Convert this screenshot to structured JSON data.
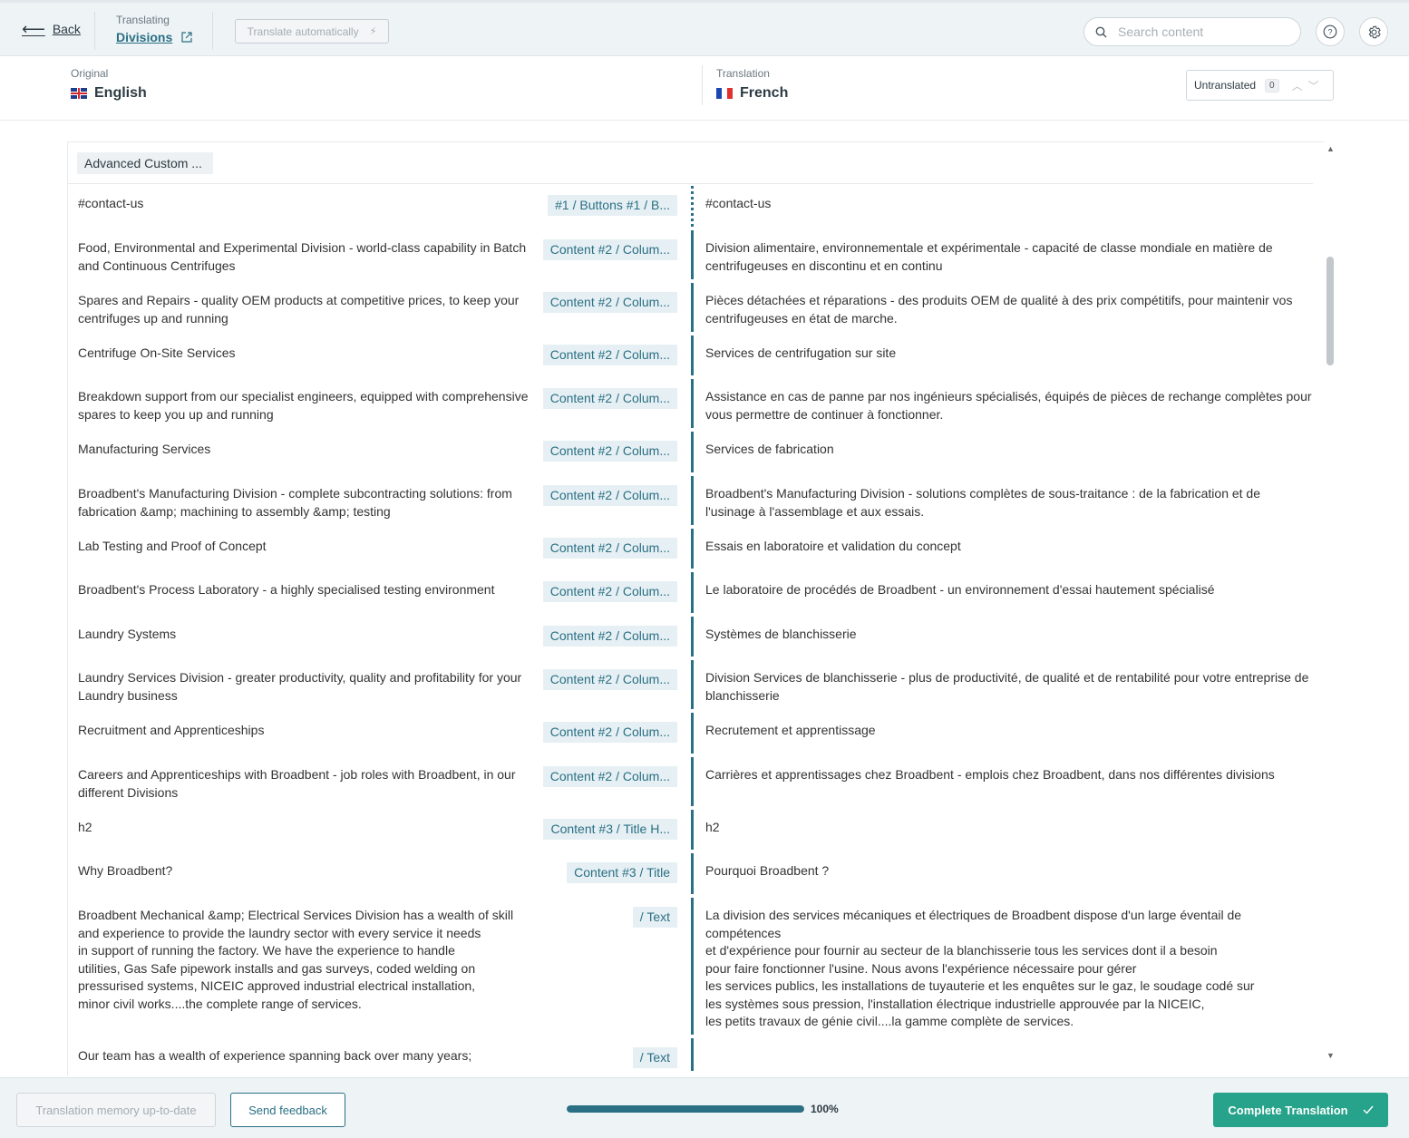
{
  "header": {
    "back_label": "Back",
    "translating_label": "Translating",
    "page_title": "Divisions",
    "auto_translate_label": "Translate automatically",
    "search_placeholder": "Search content"
  },
  "languages": {
    "original_label": "Original",
    "original_name": "English",
    "translation_label": "Translation",
    "translation_name": "French",
    "untranslated_label": "Untranslated",
    "untranslated_count": "0"
  },
  "group": {
    "label": "Advanced Custom ..."
  },
  "rows": [
    {
      "orig": "#contact-us",
      "path": "#1 / Buttons #1 / B...",
      "trans": "#contact-us",
      "pending": true
    },
    {
      "orig": "Food, Environmental and Experimental Division - world-class capability in Batch and Continuous Centrifuges",
      "path": "Content #2 / Colum...",
      "trans": "Division alimentaire, environnementale et expérimentale - capacité de classe mondiale en matière de centrifugeuses en discontinu et en continu"
    },
    {
      "orig": "Spares and Repairs - quality OEM products at competitive prices, to keep your centrifuges up and running",
      "path": "Content #2 / Colum...",
      "trans": "Pièces détachées et réparations - des produits OEM de qualité à des prix compétitifs, pour maintenir vos centrifugeuses en état de marche."
    },
    {
      "orig": "Centrifuge On-Site Services",
      "path": "Content #2 / Colum...",
      "trans": "Services de centrifugation sur site"
    },
    {
      "orig": "Breakdown support from our specialist engineers, equipped with comprehensive spares to keep you up and running",
      "path": "Content #2 / Colum...",
      "trans": "Assistance en cas de panne par nos ingénieurs spécialisés, équipés de pièces de rechange complètes pour vous permettre de continuer à fonctionner."
    },
    {
      "orig": "Manufacturing Services",
      "path": "Content #2 / Colum...",
      "trans": "Services de fabrication"
    },
    {
      "orig": "Broadbent's Manufacturing Division - complete subcontracting solutions: from fabrication &amp; machining to assembly &amp; testing",
      "path": "Content #2 / Colum...",
      "trans": "Broadbent's Manufacturing Division - solutions complètes de sous-traitance : de la fabrication et de l'usinage à l'assemblage et aux essais."
    },
    {
      "orig": "Lab Testing and Proof of Concept",
      "path": "Content #2 / Colum...",
      "trans": "Essais en laboratoire et validation du concept"
    },
    {
      "orig": "Broadbent's Process Laboratory - a highly specialised testing environment",
      "path": "Content #2 / Colum...",
      "trans": "Le laboratoire de procédés de Broadbent - un environnement d'essai hautement spécialisé"
    },
    {
      "orig": "Laundry Systems",
      "path": "Content #2 / Colum...",
      "trans": "Systèmes de blanchisserie"
    },
    {
      "orig": "Laundry Services Division - greater productivity, quality and profitability for your Laundry business",
      "path": "Content #2 / Colum...",
      "trans": "Division Services de blanchisserie - plus de productivité, de qualité et de rentabilité pour votre entreprise de blanchisserie"
    },
    {
      "orig": "Recruitment and Apprenticeships",
      "path": "Content #2 / Colum...",
      "trans": "Recrutement et apprentissage"
    },
    {
      "orig": "Careers and Apprenticeships with Broadbent - job roles with Broadbent, in our different Divisions",
      "path": "Content #2 / Colum...",
      "trans": "Carrières et apprentissages chez Broadbent - emplois chez Broadbent, dans nos différentes divisions"
    },
    {
      "orig": "h2",
      "path": "Content #3 / Title H...",
      "trans": "h2"
    },
    {
      "orig": "Why Broadbent?",
      "path": "Content #3 / Title",
      "trans": "Pourquoi Broadbent ?"
    },
    {
      "orig": "Broadbent Mechanical &amp; Electrical Services Division has a wealth of skill\nand experience to provide the laundry sector with every service it needs\nin support of running the factory. We have the experience to handle\nutilities, Gas Safe pipework installs and gas surveys, coded welding on\npressurised systems, NICEIC approved industrial electrical installation,\nminor civil works....the complete range of services.",
      "path": "/ Text",
      "trans": "La division des services mécaniques et électriques de Broadbent dispose d'un large éventail de compétences\net d'expérience pour fournir au secteur de la blanchisserie tous les services dont il a besoin\npour faire fonctionner l'usine. Nous avons l'expérience nécessaire pour gérer\nles services publics, les installations de tuyauterie et les enquêtes sur le gaz, le soudage codé sur\nles systèmes sous pression, l'installation électrique industrielle approuvée par la NICEIC,\nles petits travaux de génie civil....la gamme complète de services."
    },
    {
      "orig": "Our team has a wealth of experience spanning back over many years;",
      "path": "/ Text",
      "trans": ""
    }
  ],
  "footer": {
    "tm_label": "Translation memory up-to-date",
    "feedback_label": "Send feedback",
    "progress_percent": 100,
    "progress_label": "100%",
    "complete_label": "Complete Translation"
  },
  "icons": {
    "back": "arrow-left-icon",
    "external": "external-link-icon",
    "auto": "lightning-icon",
    "search": "search-icon",
    "help": "help-icon",
    "settings": "gear-icon",
    "complete": "check-icon"
  },
  "colors": {
    "accent": "#2a6f84",
    "success": "#26a38a",
    "header_bg": "#eef3f6"
  }
}
